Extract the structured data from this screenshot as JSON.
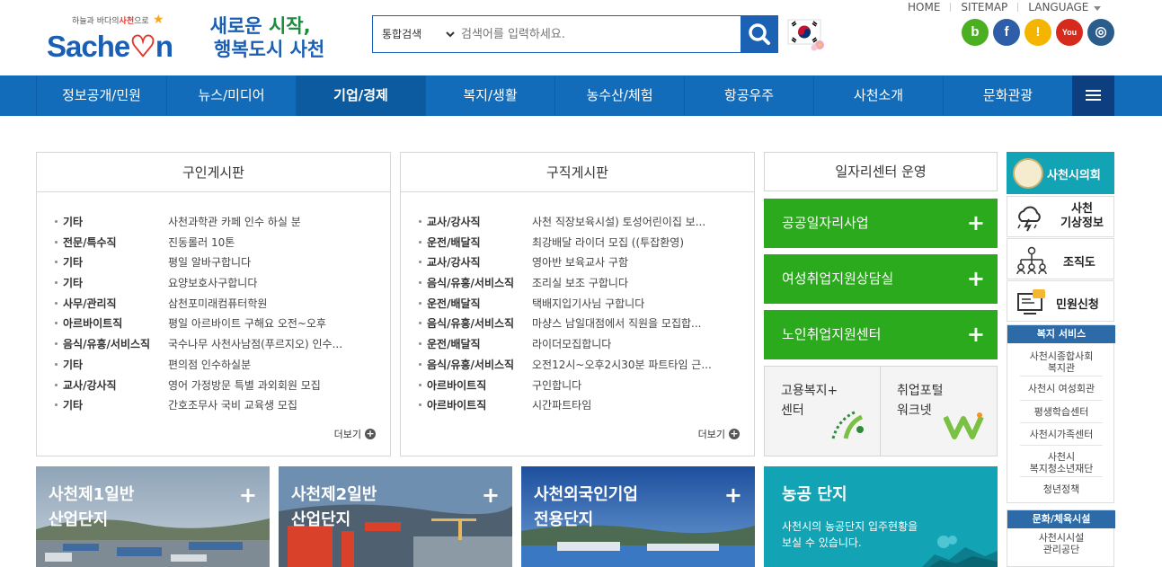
{
  "header": {
    "logo_tagline_pre": "하늘과 바다의",
    "logo_tagline_city": "사천",
    "logo_tagline_post": "으로",
    "logo_text": "Sache",
    "logo_text_end": "n",
    "slogan_line1_a": "새로운",
    "slogan_line1_b": "시작,",
    "slogan_line2_a": "행복도시",
    "slogan_line2_b": "사천",
    "search_scope": "통합검색",
    "search_placeholder": "검색어를 입력하세요.",
    "top_links": [
      "HOME",
      "SITEMAP",
      "LANGUAGE"
    ],
    "sns": [
      {
        "name": "blog",
        "glyph": "b",
        "color": "#4caf22"
      },
      {
        "name": "facebook",
        "glyph": "f",
        "color": "#2f5ea8"
      },
      {
        "name": "kakaostory",
        "glyph": "!",
        "color": "#f4b500"
      },
      {
        "name": "youtube",
        "glyph": "You",
        "color": "#d62a1d"
      },
      {
        "name": "instagram",
        "glyph": "◎",
        "color": "#2a5d8c"
      }
    ]
  },
  "nav": {
    "items": [
      "정보공개/민원",
      "뉴스/미디어",
      "기업/경제",
      "복지/생활",
      "농수산/체험",
      "항공우주",
      "사천소개",
      "문화관광"
    ],
    "active_index": 2
  },
  "job_offer_board": {
    "title": "구인게시판",
    "more": "더보기",
    "rows": [
      {
        "cat": "기타",
        "title": "사천과학관 카페 인수 하실 분"
      },
      {
        "cat": "전문/특수직",
        "title": "진동롤러 10톤"
      },
      {
        "cat": "기타",
        "title": "평일 알바구합니다"
      },
      {
        "cat": "기타",
        "title": "요양보호사구합니다"
      },
      {
        "cat": "사무/관리직",
        "title": "삼천포미래컴퓨터학원"
      },
      {
        "cat": "아르바이트직",
        "title": "평일 아르바이트 구해요 오전~오후"
      },
      {
        "cat": "음식/유흥/서비스직",
        "title": "국수나무 사천사남점(푸르지오) 인수..."
      },
      {
        "cat": "기타",
        "title": "편의점 인수하실분"
      },
      {
        "cat": "교사/강사직",
        "title": "영어 가정방문 특별 과외회원 모집"
      },
      {
        "cat": "기타",
        "title": "간호조무사 국비 교육생 모집"
      }
    ]
  },
  "job_seek_board": {
    "title": "구직게시판",
    "more": "더보기",
    "rows": [
      {
        "cat": "교사/강사직",
        "title": "사천 직장보육시설) 토성어린이집 보..."
      },
      {
        "cat": "운전/배달직",
        "title": "최강배달 라이더 모집 ((투잡환영)"
      },
      {
        "cat": "교사/강사직",
        "title": "영아반 보육교사 구함"
      },
      {
        "cat": "음식/유흥/서비스직",
        "title": "조리실 보조 구합니다"
      },
      {
        "cat": "운전/배달직",
        "title": "택배지입기사님 구합니다"
      },
      {
        "cat": "음식/유흥/서비스직",
        "title": "마샹스 남일대점에서 직원을 모집합..."
      },
      {
        "cat": "운전/배달직",
        "title": "라이더모집합니다"
      },
      {
        "cat": "음식/유흥/서비스직",
        "title": "오전12시~오후2시30분 파트타임 근..."
      },
      {
        "cat": "아르바이트직",
        "title": "구인합니다"
      },
      {
        "cat": "아르바이트직",
        "title": "시간파트타임"
      }
    ]
  },
  "job_center": {
    "title": "일자리센터 운영",
    "buttons": [
      "공공일자리사업",
      "여성취업지원상담실",
      "노인취업지원센터"
    ],
    "links": [
      {
        "line1": "고용복지+",
        "line2": "센터"
      },
      {
        "line1": "취업포털",
        "line2": "워크넷"
      }
    ]
  },
  "tiles": [
    {
      "line1": "사천제1일반",
      "line2": "산업단지",
      "plus": "+"
    },
    {
      "line1": "사천제2일반",
      "line2": "산업단지",
      "plus": "+"
    },
    {
      "line1": "사천외국인기업",
      "line2": "전용단지",
      "plus": "+"
    },
    {
      "line1": "농공 단지",
      "desc1": "사천시의 농공단지 입주현황을",
      "desc2": "보실 수 있습니다."
    }
  ],
  "right_side": {
    "council": "사천시의회",
    "weather_l1": "사천",
    "weather_l2": "기상정보",
    "org": "조직도",
    "civil": "민원신청",
    "welfare_title": "복지 서비스",
    "welfare_links": [
      {
        "l1": "사천시종합사회",
        "l2": "복지관"
      },
      {
        "l1": "사천시 여성회관",
        "l2": ""
      },
      {
        "l1": "평생학습센터",
        "l2": ""
      },
      {
        "l1": "사천시가족센터",
        "l2": ""
      },
      {
        "l1": "사천시",
        "l2": "복지청소년재단"
      },
      {
        "l1": "청년정책",
        "l2": ""
      }
    ],
    "culture_title": "문화/체육시설",
    "culture_links": [
      {
        "l1": "사천시시설",
        "l2": "관리공단"
      }
    ]
  }
}
